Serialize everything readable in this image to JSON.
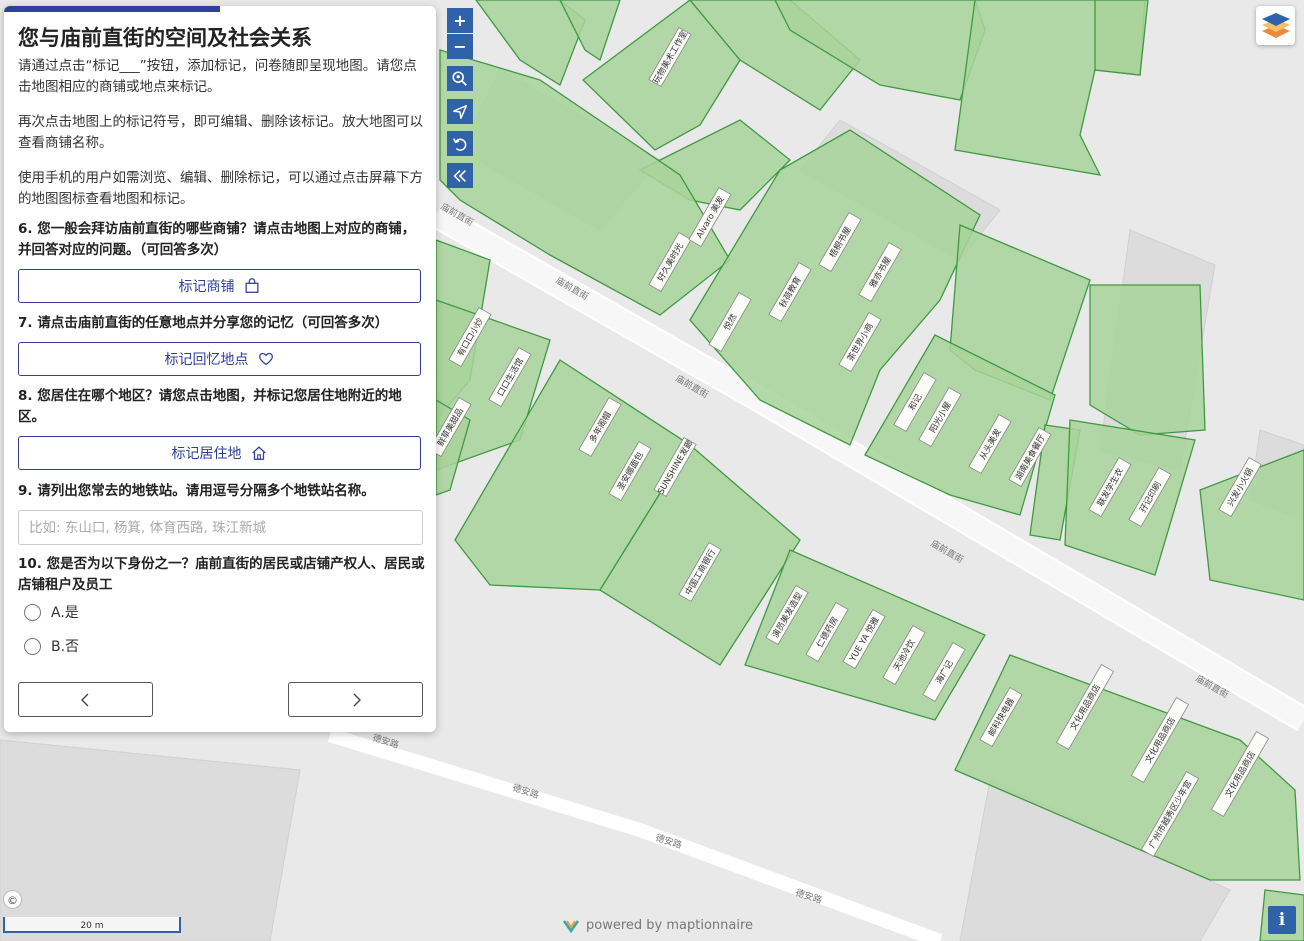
{
  "survey": {
    "title": "您与庙前直街的空间及社会关系",
    "intro_1": "请通过点击“标记___”按钮，添加标记，问卷随即呈现地图。请您点击地图相应的商铺或地点来标记。",
    "intro_2": "再次点击地图上的标记符号，即可编辑、删除该标记。放大地图可以查看商铺名称。",
    "intro_3": "使用手机的用户如需浏览、编辑、删除标记，可以通过点击屏幕下方的地图图标查看地图和标记。",
    "q6": "6. 您一般会拜访庙前直街的哪些商铺？请点击地图上对应的商铺，并回答对应的问题。（可回答多次）",
    "q6_button": "标记商铺",
    "q7": "7. 请点击庙前直街的任意地点并分享您的记忆（可回答多次）",
    "q7_button": "标记回忆地点",
    "q8": "8. 您居住在哪个地区？请您点击地图，并标记您居住地附近的地区。",
    "q8_button": "标记居住地",
    "q9": "9. 请列出您常去的地铁站。请用逗号分隔多个地铁站名称。",
    "q9_placeholder": "比如: 东山口, 杨箕, 体育西路, 珠江新城",
    "q10": "10. 您是否为以下身份之一？庙前直街的居民或店铺产权人、居民或店铺租户及员工",
    "q10_options": [
      "A.是",
      "B.否"
    ],
    "progress": 0.5
  },
  "map": {
    "zoom_in": "+",
    "zoom_out": "−",
    "scale_label": "20 m",
    "powered_by": "powered by maptionnaire",
    "info_label": "i",
    "attribution_symbol": "©",
    "street_labels": [
      "庙前直街",
      "庙前直街",
      "庙前直街",
      "庙前直街",
      "庙前直街",
      "德安路",
      "德安路",
      "德安路",
      "德安路"
    ],
    "shop_labels": [
      "玩物美术工作室",
      "好久美时光",
      "Alvaro 美发",
      "中国工商银行",
      "演员美发造型",
      "仁德药房",
      "YUE YA 悦雅",
      "天池冷饮",
      "海广记",
      "邮科快电器",
      "文化用品商店",
      "文化用品商店",
      "文化用品商店",
      "广州市越秀区少年宫",
      "秋荷教育",
      "梧桐书屋",
      "雅亦书屋",
      "汇源影",
      "口口凉",
      "甜沙园",
      "番茄我",
      "拓斯地产",
      "SUNSHINE发廊",
      "圣安娜面包",
      "多年阁帽",
      "汤品坊",
      "有口口小炒",
      "口口生活馆",
      "鲜草美甜品",
      "悦然",
      "茶世界小商",
      "风行手机",
      "秀然衣",
      "和记",
      "阳光小屋",
      "福记",
      "从头美发",
      "湖南美食餐厅",
      "联发学生衣",
      "孖记印刷",
      "兴发小火锅",
      "新天地",
      "旺角",
      "庙前书店",
      "美香快餐厅",
      "秀宝美食"
    ],
    "accent_color": "#2f62a8",
    "building_fill": "#a8d39a",
    "building_stroke": "#3e9a42"
  }
}
